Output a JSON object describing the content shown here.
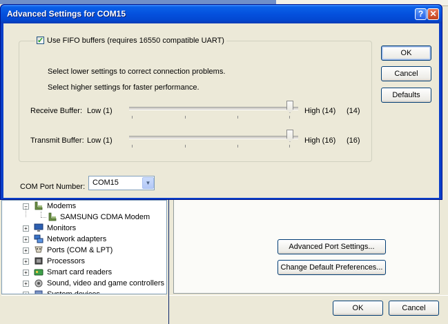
{
  "dialog": {
    "title": "Advanced Settings for COM15",
    "help_glyph": "?",
    "close_glyph": "✕",
    "fifo_checkbox_label": "Use FIFO buffers (requires 16550 compatible UART)",
    "fifo_checked": true,
    "hint_lower": "Select lower settings to correct connection problems.",
    "hint_higher": "Select higher settings for faster performance.",
    "receive_buffer": {
      "label": "Receive Buffer:",
      "low": "Low (1)",
      "high": "High (14)",
      "value_text": "(14)",
      "value": 14,
      "max": 14
    },
    "transmit_buffer": {
      "label": "Transmit Buffer:",
      "low": "Low (1)",
      "high": "High (16)",
      "value_text": "(16)",
      "value": 16,
      "max": 16
    },
    "com_port_label": "COM Port Number:",
    "com_port_value": "COM15",
    "buttons": {
      "ok": "OK",
      "cancel": "Cancel",
      "defaults": "Defaults"
    }
  },
  "device_manager": {
    "items": [
      {
        "label": "Modems",
        "expanded": true,
        "icon": "modem-icon"
      },
      {
        "label": "SAMSUNG CDMA Modem",
        "child": true,
        "icon": "modem-icon"
      },
      {
        "label": "Monitors",
        "expanded": false,
        "icon": "monitor-icon"
      },
      {
        "label": "Network adapters",
        "expanded": false,
        "icon": "network-icon"
      },
      {
        "label": "Ports (COM & LPT)",
        "expanded": false,
        "icon": "port-icon"
      },
      {
        "label": "Processors",
        "expanded": false,
        "icon": "processor-icon"
      },
      {
        "label": "Smart card readers",
        "expanded": false,
        "icon": "smartcard-icon"
      },
      {
        "label": "Sound, video and game controllers",
        "expanded": false,
        "icon": "sound-icon"
      },
      {
        "label": "System devices",
        "expanded": false,
        "icon": "system-icon"
      }
    ],
    "expand_glyph": "+",
    "collapse_glyph": "−"
  },
  "port_properties": {
    "advanced_button": "Advanced Port Settings...",
    "change_defaults_button": "Change Default Preferences...",
    "ok": "OK",
    "cancel": "Cancel"
  }
}
